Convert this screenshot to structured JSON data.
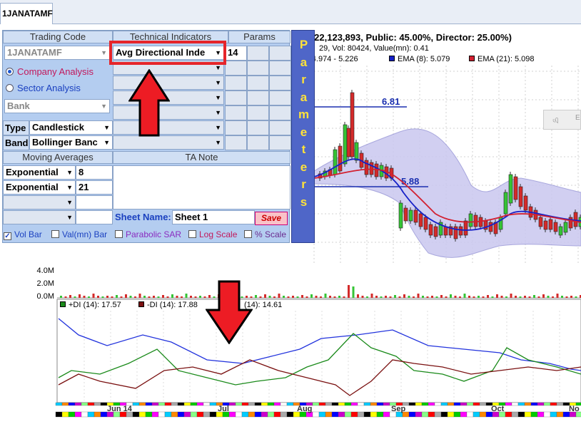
{
  "tab": {
    "label": "1JANATAMF"
  },
  "stats": {
    "line1": ": 222,123,893, Public: 45.00%, Director: 25.00%)",
    "line2": "29, Vol: 80424, Value(mn): 0.41"
  },
  "legend": {
    "bb": "): 4.974 - 5.226",
    "ema8": "EMA (8): 5.079",
    "ema21": "EMA (21): 5.098",
    "ema8_color": "#1520c8",
    "ema21_color": "#d22030"
  },
  "levels": {
    "upper": "6.81",
    "lower": "5.88"
  },
  "volume_axis": [
    "4.0M",
    "2.0M",
    "0.0M"
  ],
  "indicator_legend": {
    "plus_di": "+DI (14): 17.57",
    "minus_di": "-DI (14): 17.88",
    "adx": "(14): 14.61"
  },
  "date_labels": [
    "Jun 14",
    "Jul",
    "Aug",
    "Sep",
    "Oct",
    "No"
  ],
  "panel": {
    "headers": {
      "trading_code": "Trading Code",
      "technical_indicators": "Technical Indicators",
      "params": "Params",
      "moving_averages": "Moving Averages",
      "ta_note": "TA Note"
    },
    "trading_code_value": "1JANATAMF",
    "company_analysis": "Company Analysis",
    "sector_analysis": "Sector Analysis",
    "sector_value": "Bank",
    "type_label": "Type",
    "type_value": "Candlestick",
    "band_label": "Band",
    "band_value": "Bollinger Banc",
    "indicator_1": "Avg Directional Inde",
    "param_1": "14",
    "ma_1_type": "Exponential",
    "ma_1_value": "8",
    "ma_2_type": "Exponential",
    "ma_2_value": "21",
    "sheet_name_label": "Sheet Name:",
    "sheet_name_value": "Sheet 1",
    "save_label": "Save",
    "checkboxes": {
      "vol_bar": "Vol Bar",
      "valmn_bar": "Val(mn) Bar",
      "parabolic_sar": "Parabolic SAR",
      "log_scale": "Log Scale",
      "pct_scale": "% Scale"
    }
  },
  "params_strip": "Parameters",
  "tool_label": "এ"
}
